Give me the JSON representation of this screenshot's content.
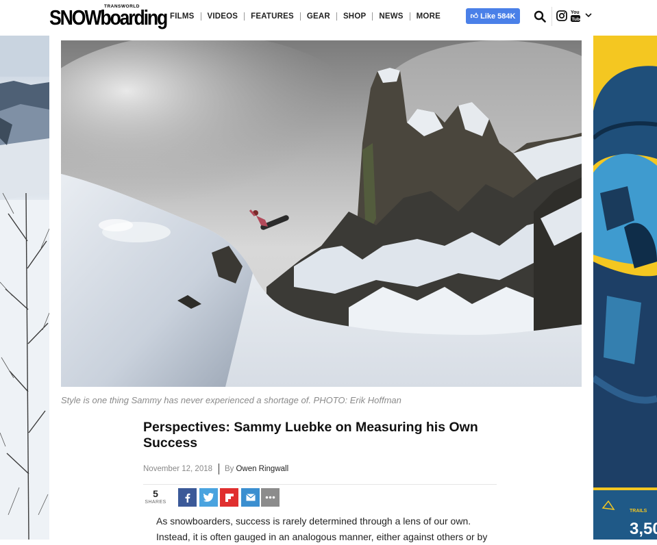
{
  "brand": {
    "logo_main": "SNOWboarding",
    "logo_sub": "TRANSWORLD"
  },
  "nav": {
    "items": [
      "FILMS",
      "VIDEOS",
      "FEATURES",
      "GEAR",
      "SHOP",
      "NEWS",
      "MORE"
    ]
  },
  "social": {
    "like_label": "Like 584K",
    "icons": [
      "search-icon",
      "instagram-icon",
      "youtube-icon",
      "chevron-down-icon"
    ]
  },
  "hero": {
    "caption": "Style is one thing Sammy has never experienced a shortage of. PHOTO: Erik Hoffman"
  },
  "article": {
    "title": "Perspectives: Sammy Luebke on Measuring his Own Success",
    "date": "November 12, 2018",
    "by": "By",
    "author": "Owen Ringwall",
    "shares_count": "5",
    "shares_label": "SHARES",
    "share_buttons": [
      "facebook",
      "twitter",
      "flipboard",
      "email",
      "more"
    ],
    "body_line_1": "As snowboarders, success is rarely determined through a lens of our own.",
    "body_line_2": "Instead, it is often gauged in an analogous manner, either against others or by"
  },
  "right_ad": {
    "label": "TRAILS",
    "value": "3,50"
  },
  "colors": {
    "like_button": "#4a80e8",
    "facebook": "#3b5998",
    "twitter": "#4aa3df",
    "flipboard": "#e02f2f",
    "email": "#3b8fd0",
    "more": "#8c8c8c",
    "ad_yellow": "#f4c721"
  }
}
